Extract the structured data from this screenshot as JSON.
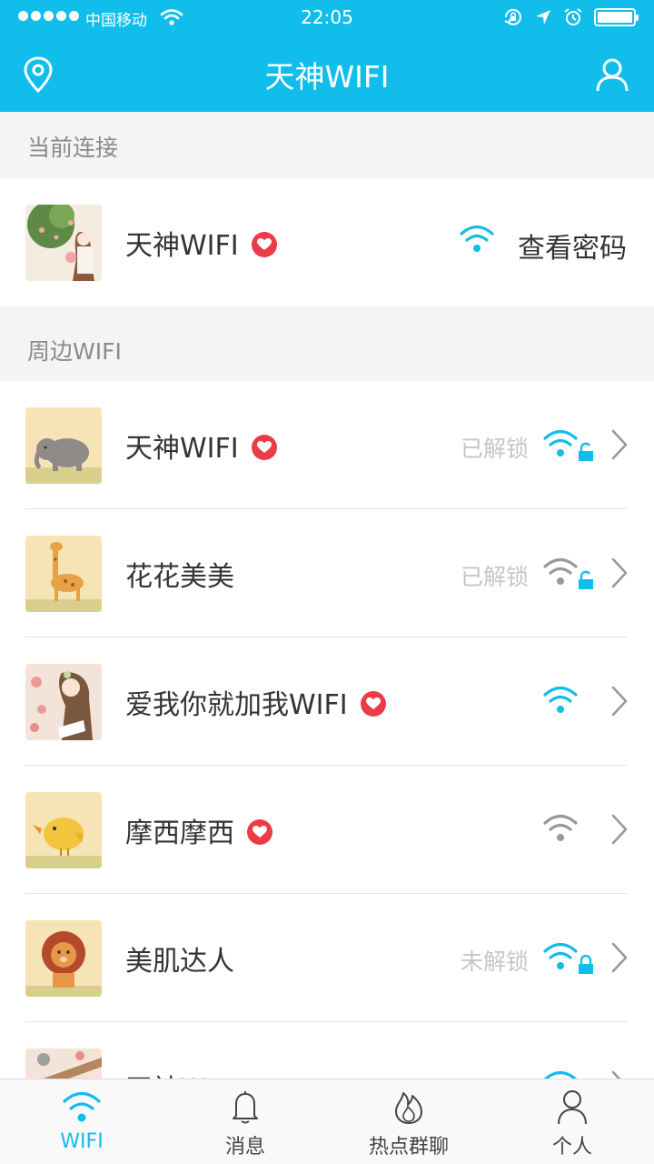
{
  "status_bar": {
    "carrier": "中国移动",
    "time": "22:05"
  },
  "nav": {
    "title": "天神WIFI",
    "left_icon": "location-pin-icon",
    "right_icon": "user-icon"
  },
  "colors": {
    "brand": "#11bdea",
    "heart": "#ea3b47",
    "muted": "#c6c6c6"
  },
  "current_section": {
    "header": "当前连接",
    "item": {
      "name": "天神WIFI",
      "favorite": true,
      "action": "查看密码"
    }
  },
  "nearby_section": {
    "header": "周边WIFI",
    "items": [
      {
        "name": "天神WIFI",
        "favorite": true,
        "status": "已解锁",
        "lock": "unlocked",
        "signal_color": "#11bdea"
      },
      {
        "name": "花花美美",
        "favorite": false,
        "status": "已解锁",
        "lock": "unlocked",
        "signal_color": "#999999"
      },
      {
        "name": "爱我你就加我WIFI",
        "favorite": true,
        "status": "",
        "lock": "none",
        "signal_color": "#11bdea"
      },
      {
        "name": "摩西摩西",
        "favorite": true,
        "status": "",
        "lock": "none",
        "signal_color": "#999999"
      },
      {
        "name": "美肌达人",
        "favorite": false,
        "status": "未解锁",
        "lock": "locked",
        "signal_color": "#11bdea"
      },
      {
        "name": "天神WIFI",
        "favorite": false,
        "status": "",
        "lock": "none",
        "signal_color": "#11bdea"
      }
    ]
  },
  "tabs": [
    {
      "label": "WIFI",
      "icon": "wifi-icon",
      "active": true
    },
    {
      "label": "消息",
      "icon": "bell-icon",
      "active": false
    },
    {
      "label": "热点群聊",
      "icon": "flame-icon",
      "active": false
    },
    {
      "label": "个人",
      "icon": "person-icon",
      "active": false
    }
  ]
}
